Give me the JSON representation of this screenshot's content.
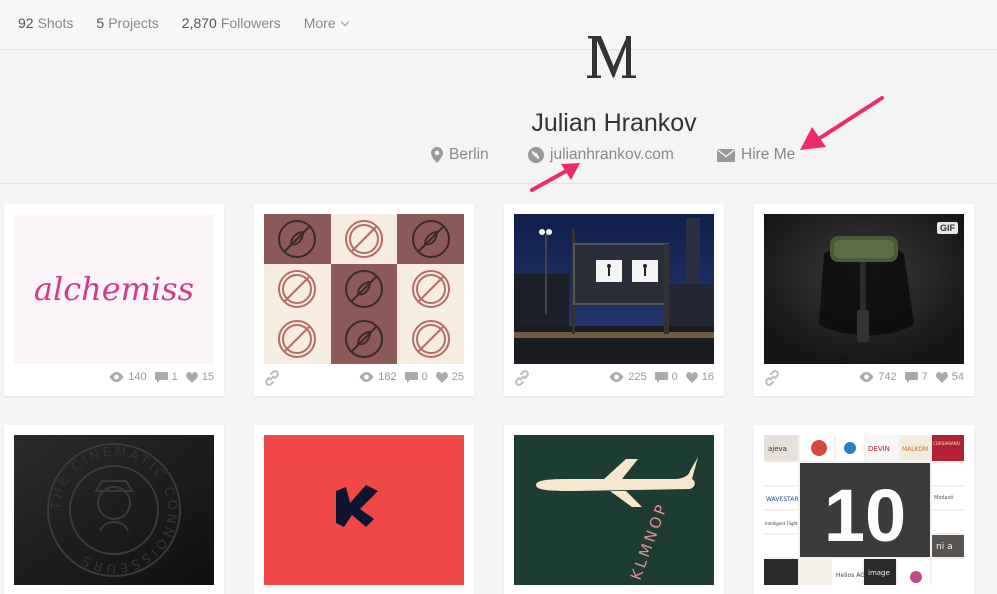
{
  "topbar": {
    "stats": [
      {
        "num": "92",
        "label": "Shots"
      },
      {
        "num": "5",
        "label": "Projects"
      },
      {
        "num": "2,870",
        "label": "Followers"
      }
    ],
    "more_label": "More"
  },
  "profile": {
    "name": "Julian Hrankov",
    "location": "Berlin",
    "website": "julianhrankov.com",
    "hire_label": "Hire Me"
  },
  "shots": [
    {
      "views": "140",
      "comments": "1",
      "likes": "15",
      "art": "alchemiss"
    },
    {
      "views": "182",
      "comments": "0",
      "likes": "25",
      "art": "pattern"
    },
    {
      "views": "225",
      "comments": "0",
      "likes": "16",
      "art": "billboard"
    },
    {
      "views": "742",
      "comments": "7",
      "likes": "54",
      "gif_label": "GIF",
      "art": "roller"
    },
    {
      "art": "emboss",
      "emboss_text": "THE CINEMATIC CONNOISSEURS"
    },
    {
      "art": "plane-logo"
    },
    {
      "art": "klm",
      "klm_text": "KLMNOP"
    },
    {
      "art": "collage",
      "number": "10",
      "tile_labels": [
        "ajeva",
        "DEVIN",
        "WAVESTAR",
        "Helios AG",
        "image",
        "ni a",
        "Intelligent Flight",
        "Modasti",
        "MALKOM",
        "CORSARIANO"
      ]
    }
  ],
  "alchemiss_text": "alchemiss",
  "colors": {
    "accent": "#ee2a6c",
    "brown": "#8c5a58",
    "cream": "#f6ece0"
  }
}
